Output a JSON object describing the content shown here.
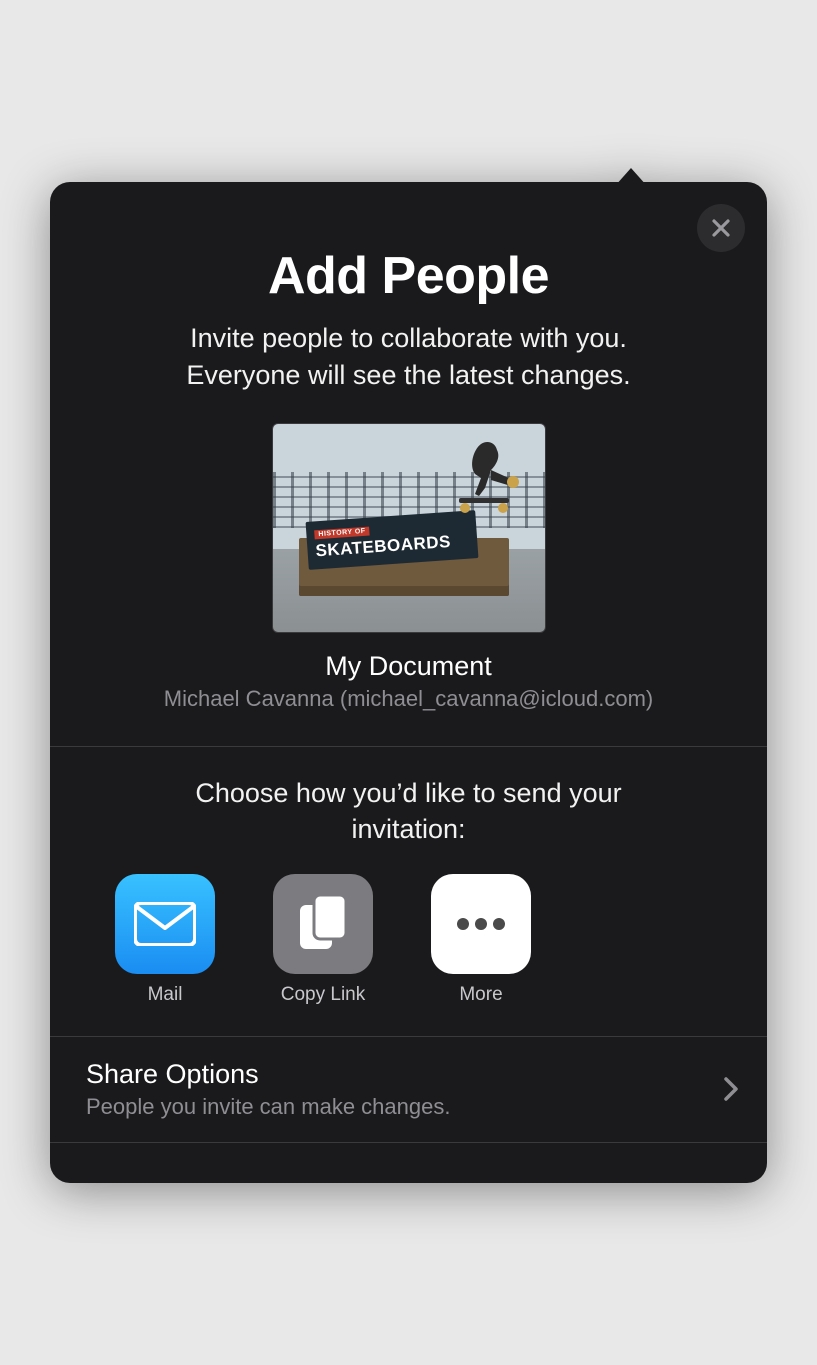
{
  "header": {
    "title": "Add People",
    "subtitle": "Invite people to collaborate with you. Everyone will see the latest changes."
  },
  "document": {
    "title": "My Document",
    "owner": "Michael Cavanna (michael_cavanna@icloud.com)",
    "thumbnail": {
      "banner_tag": "HISTORY OF",
      "banner_title": "SKATEBOARDS"
    }
  },
  "methods": {
    "prompt": "Choose how you’d like to send your invitation:",
    "items": [
      {
        "id": "mail",
        "label": "Mail",
        "icon": "mail-icon"
      },
      {
        "id": "copy-link",
        "label": "Copy Link",
        "icon": "copy-link-icon"
      },
      {
        "id": "more",
        "label": "More",
        "icon": "more-icon"
      }
    ]
  },
  "shareOptions": {
    "title": "Share Options",
    "description": "People you invite can make changes."
  }
}
